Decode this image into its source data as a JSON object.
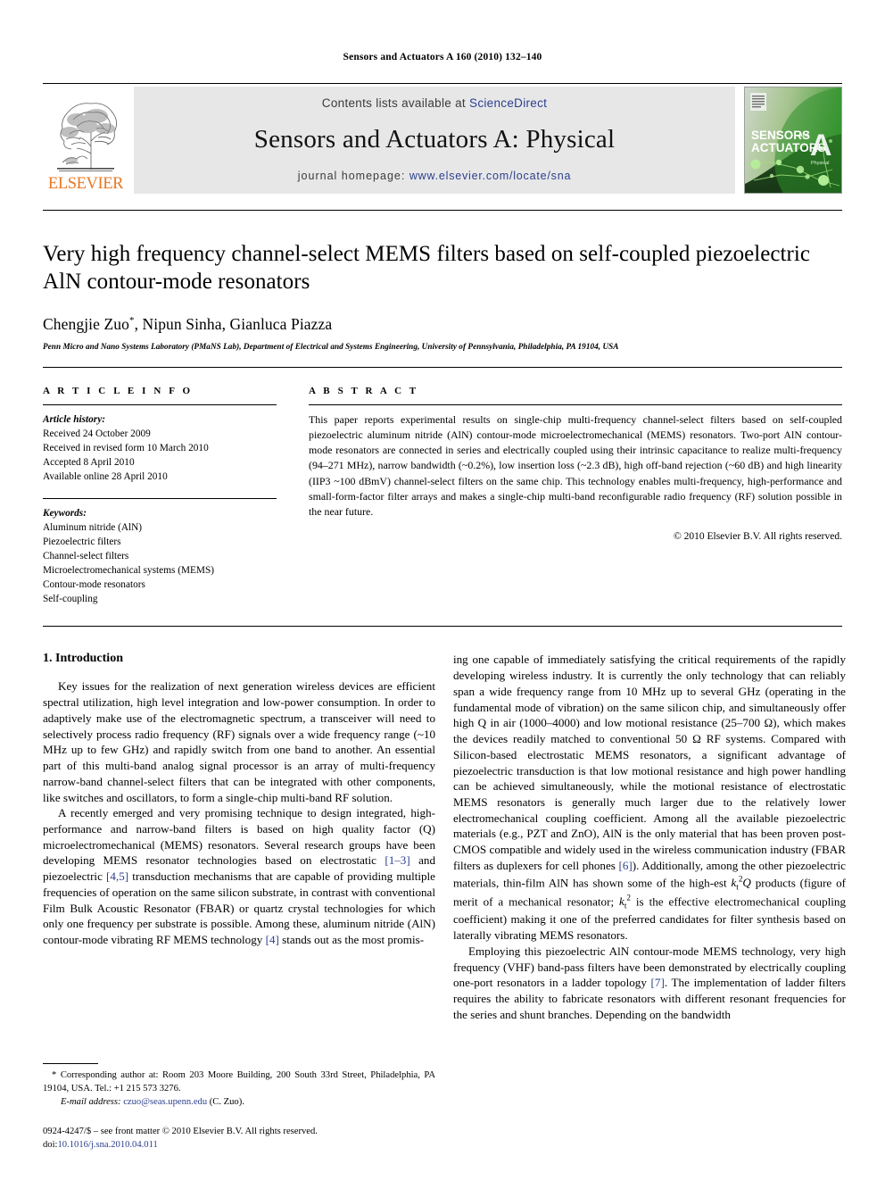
{
  "running_head": "Sensors and Actuators A 160 (2010) 132–140",
  "banner": {
    "contents_prefix": "Contents lists available at ",
    "contents_link": "ScienceDirect",
    "journal_title": "Sensors and Actuators A: Physical",
    "homepage_label": "journal homepage:",
    "homepage_url": "www.elsevier.com/locate/sna",
    "publisher_logo_text": "ELSEVIER",
    "publisher_logo_icon": "elsevier-tree-icon",
    "cover": {
      "line1": "SENSORS",
      "line2": "ACTUATORS",
      "small_and": "and",
      "big_letter": "A",
      "sub_letter": "Physical",
      "icon": "journal-cover-thumbnail"
    },
    "link_color": "#2b3f8c",
    "elsevier_orange": "#E87722",
    "banner_bg": "#e7e7e8"
  },
  "article": {
    "title": "Very high frequency channel-select MEMS filters based on self-coupled piezoelectric AlN contour-mode resonators",
    "authors": "Chengjie Zuo*, Nipun Sinha, Gianluca Piazza",
    "authors_plain": "Chengjie Zuo",
    "authors_rest": ", Nipun Sinha, Gianluca Piazza",
    "corresponding_marker": "*",
    "affiliation": "Penn Micro and Nano Systems Laboratory (PMaNS Lab), Department of Electrical and Systems Engineering, University of Pennsylvania, Philadelphia, PA 19104, USA"
  },
  "article_info": {
    "heading": "A R T I C L E    I N F O",
    "history_label": "Article history:",
    "history": [
      "Received 24 October 2009",
      "Received in revised form 10 March 2010",
      "Accepted 8 April 2010",
      "Available online 28 April 2010"
    ],
    "keywords_label": "Keywords:",
    "keywords": [
      "Aluminum nitride (AlN)",
      "Piezoelectric filters",
      "Channel-select filters",
      "Microelectromechanical systems (MEMS)",
      "Contour-mode resonators",
      "Self-coupling"
    ]
  },
  "abstract": {
    "heading": "A B S T R A C T",
    "text": "This paper reports experimental results on single-chip multi-frequency channel-select filters based on self-coupled piezoelectric aluminum nitride (AlN) contour-mode microelectromechanical (MEMS) resonators. Two-port AlN contour-mode resonators are connected in series and electrically coupled using their intrinsic capacitance to realize multi-frequency (94–271 MHz), narrow bandwidth (~0.2%), low insertion loss (~2.3 dB), high off-band rejection (~60 dB) and high linearity (IIP3 ~100 dBmV) channel-select filters on the same chip. This technology enables multi-frequency, high-performance and small-form-factor filter arrays and makes a single-chip multi-band reconfigurable radio frequency (RF) solution possible in the near future.",
    "copyright": "© 2010 Elsevier B.V. All rights reserved."
  },
  "introduction": {
    "section_number_title": "1.  Introduction",
    "left_p1": "Key issues for the realization of next generation wireless devices are efficient spectral utilization, high level integration and low-power consumption. In order to adaptively make use of the electromagnetic spectrum, a transceiver will need to selectively process radio frequency (RF) signals over a wide frequency range (~10 MHz up to few GHz) and rapidly switch from one band to another. An essential part of this multi-band analog signal processor is an array of multi-frequency narrow-band channel-select filters that can be integrated with other components, like switches and oscillators, to form a single-chip multi-band RF solution.",
    "left_p2_a": "A recently emerged and very promising technique to design integrated, high-performance and narrow-band filters is based on high quality factor (Q) microelectromechanical (MEMS) resonators. Several research groups have been developing MEMS resonator technologies based on electrostatic ",
    "left_p2_ref1": "[1–3]",
    "left_p2_b": " and piezoelectric ",
    "left_p2_ref2": "[4,5]",
    "left_p2_c": " transduction mechanisms that are capable of providing multiple frequencies of operation on the same silicon substrate, in contrast with conventional Film Bulk Acoustic Resonator (FBAR) or quartz crystal technologies for which only one frequency per substrate is possible. Among these, aluminum nitride (AlN) contour-mode vibrating RF MEMS technology ",
    "left_p2_ref3": "[4]",
    "left_p2_d": " stands out as the most promis-",
    "right_p1_a": "ing one capable of immediately satisfying the critical requirements of the rapidly developing wireless industry. It is currently the only technology that can reliably span a wide frequency range from 10 MHz up to several GHz (operating in the fundamental mode of vibration) on the same silicon chip, and simultaneously offer high Q in air (1000–4000) and low motional resistance (25–700 Ω), which makes the devices readily matched to conventional 50 Ω RF systems. Compared with Silicon-based electrostatic MEMS resonators, a significant advantage of piezoelectric transduction is that low motional resistance and high power handling can be achieved simultaneously, while the motional resistance of electrostatic MEMS resonators is generally much larger due to the relatively lower electromechanical coupling coefficient. Among all the available piezoelectric materials (e.g., PZT and ZnO), AlN is the only material that has been proven post-CMOS compatible and widely used in the wireless communication industry (FBAR filters as duplexers for cell phones ",
    "right_p1_ref": "[6]",
    "right_p1_b": "). Additionally, among the other piezoelectric materials, thin-film AlN has shown some of the high-est ",
    "right_p1_c": " products (figure of merit of a mechanical resonator; ",
    "right_p1_d": " is the effective electromechanical coupling coefficient) making it one of the preferred candidates for filter synthesis based on laterally vibrating MEMS resonators.",
    "right_p2_a": "Employing this piezoelectric AlN contour-mode MEMS technology, very high frequency (VHF) band-pass filters have been demonstrated by electrically coupling one-port resonators in a ladder topology ",
    "right_p2_ref": "[7]",
    "right_p2_b": ". The implementation of ladder filters requires the ability to fabricate resonators with different resonant frequencies for the series and shunt branches. Depending on the bandwidth"
  },
  "footnote": {
    "corresponding": "* Corresponding author at: Room 203 Moore Building, 200 South 33rd Street, Philadelphia, PA 19104, USA. Tel.: +1 215 573 3276.",
    "email_label": "E-mail address:",
    "email": "czuo@seas.upenn.edu",
    "email_suffix": " (C. Zuo).",
    "issn_line": "0924-4247/$ – see front matter © 2010 Elsevier B.V. All rights reserved.",
    "doi_label": "doi:",
    "doi_value": "10.1016/j.sna.2010.04.011"
  }
}
